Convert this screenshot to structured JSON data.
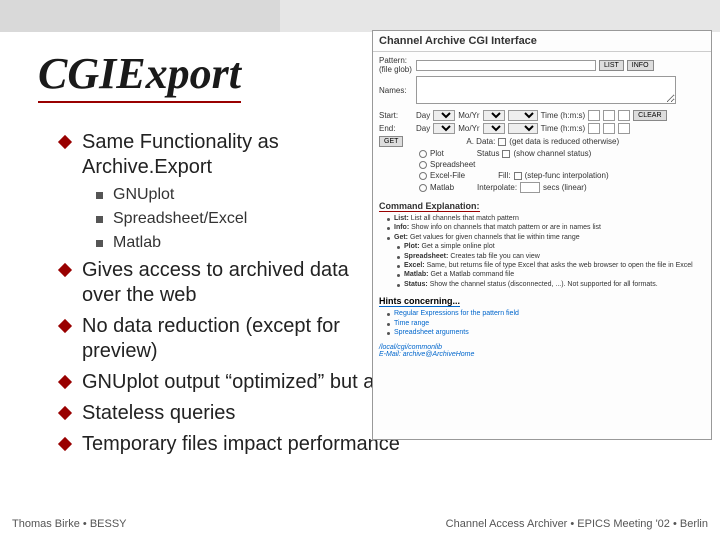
{
  "title": "CGIExport",
  "bullets": {
    "b1": "Same Functionality as Archive.Export",
    "s1": "GNUplot",
    "s2": "Spreadsheet/Excel",
    "s3": "Matlab",
    "b2": "Gives access to archived data over the web",
    "b3": "No data reduction (except for preview)",
    "b4": "GNUplot output “optimized” but auto-scales y-axis",
    "b5": "Stateless queries",
    "b6": "Temporary files impact performance"
  },
  "footer": {
    "left": "Thomas Birke • BESSY",
    "right": "Channel Access Archiver • EPICS Meeting '02 • Berlin"
  },
  "cgi": {
    "heading": "Channel Archive CGI Interface",
    "pattern": "Pattern: (file glob)",
    "names": "Names:",
    "list": "LIST",
    "info": "INFO",
    "start": "Start:",
    "end": "End:",
    "day": "Day",
    "moyr": "Mo/Yr",
    "time": "Time (h:m:s)",
    "get": "GET",
    "getlbl": "A. Data:",
    "getopt": "(get data is reduced otherwise)",
    "plot": "Plot",
    "spread": "Spreadsheet",
    "excel": "Excel-File",
    "matlab": "Matlab",
    "status": "Status",
    "statusopt": "(show channel status)",
    "fill": "Fill:",
    "fillopt": "(step-func interpolation)",
    "interp": "Interpolate:",
    "interpopt": "secs (linear)",
    "cmd_h": "Command Explanation:",
    "cmd1b": "List:",
    "cmd1": "List all channels that match pattern",
    "cmd2b": "Info:",
    "cmd2": "Show info on channels that match pattern or are in names list",
    "cmd3b": "Get:",
    "cmd3": "Get values for given channels that lie within time range",
    "cmd4b": "Plot:",
    "cmd4": "Get a simple online plot",
    "cmd5b": "Spreadsheet:",
    "cmd5": "Creates tab file you can view",
    "cmd6b": "Excel:",
    "cmd6": "Same, but returns file of type Excel that asks the web browser to open the file in Excel",
    "cmd7b": "Matlab:",
    "cmd7": "Get a Matlab command file",
    "cmd8b": "Status:",
    "cmd8": "Show the channel status (disconnected, ...). Not supported for all formats.",
    "hints_h": "Hints concerning...",
    "h1": "Regular Expressions for the pattern field",
    "h2": "Time range",
    "h3": "Spreadsheet arguments",
    "url1": "/local/cgi/commonlib",
    "url2": "E-Mail:  archive@ArchiveHome"
  }
}
